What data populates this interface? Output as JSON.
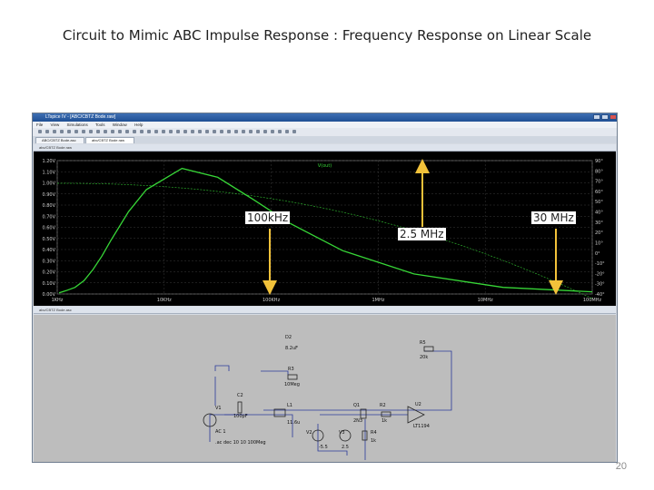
{
  "slide": {
    "title": "Circuit to Mimic ABC Impulse Response : Frequency Response on Linear Scale",
    "page_number": "20"
  },
  "window": {
    "title": "LTspice IV - [ABC/CBTZ Bode.raw]",
    "menu": [
      "File",
      "View",
      "Simulations",
      "Tools",
      "Window",
      "Help"
    ],
    "tabs": [
      "ABC/CBTZ Bode.asc",
      "abc/CBTZ Bode.raw"
    ],
    "waveform_pane_title": "abc/CBTZ Bode.raw",
    "schematic_pane_title": "abc/CBTZ Bode.asc"
  },
  "plot": {
    "trace_label": "V(out)",
    "colors": {
      "plot_bg": "#000000",
      "grid": "#3a3a3a",
      "magnitude": "#37d637",
      "phase": "#37d637",
      "axis_text": "#d0d0d0"
    }
  },
  "chart_data": {
    "type": "line",
    "x_scale": "linear",
    "x": [
      100000,
      500000,
      1000000,
      1500000,
      2000000,
      2500000,
      3000000,
      4000000,
      5000000,
      7000000,
      9000000,
      11000000,
      13000000,
      16000000,
      20000000,
      25000000,
      30000000
    ],
    "x_tick_labels": [
      "1KHz",
      "10KHz",
      "100KHz",
      "1MHz",
      "10MHz",
      "100MHz"
    ],
    "left_tick_labels": [
      "1.20V",
      "1.10V",
      "1.00V",
      "0.90V",
      "0.80V",
      "0.70V",
      "0.60V",
      "0.50V",
      "0.40V",
      "0.30V",
      "0.20V",
      "0.10V",
      "0.00V"
    ],
    "right_tick_labels": [
      "90°",
      "80°",
      "70°",
      "60°",
      "50°",
      "40°",
      "30°",
      "20°",
      "10°",
      "0°",
      "-10°",
      "-20°",
      "-30°",
      "-40°"
    ],
    "series": [
      {
        "values": [
          0.01,
          0.03,
          0.06,
          0.12,
          0.22,
          0.34,
          0.48,
          0.74,
          0.94,
          1.13,
          1.05,
          0.85,
          0.64,
          0.39,
          0.18,
          0.06,
          0.02
        ]
      }
    ],
    "annotations": [
      {
        "label": "100kHz",
        "x": 100000
      },
      {
        "label": "2.5 MHz",
        "x": 2500000
      },
      {
        "label": "30 MHz",
        "x": 30000000
      }
    ]
  },
  "schematic": {
    "components": [
      {
        "ref": "V1",
        "value": "AC 1"
      },
      {
        "ref": "C2",
        "value": "100pF"
      },
      {
        "ref": "L1",
        "value": "11.6u"
      },
      {
        "ref": "R3",
        "value": "10Meg"
      },
      {
        "ref": "D2",
        "value": "8.2uF"
      },
      {
        "ref": "Q1",
        "value": "2N3"
      },
      {
        "ref": "R2",
        "value": "1k"
      },
      {
        "ref": "U2",
        "value": "LT1194"
      },
      {
        "ref": "R5",
        "value": "20k"
      },
      {
        "ref": "R4",
        "value": "1k"
      },
      {
        "ref": "V2",
        "value": "-5.5"
      },
      {
        "ref": "V3",
        "value": "2.5"
      }
    ],
    "directive": ".ac dec 10 10 100Meg"
  }
}
